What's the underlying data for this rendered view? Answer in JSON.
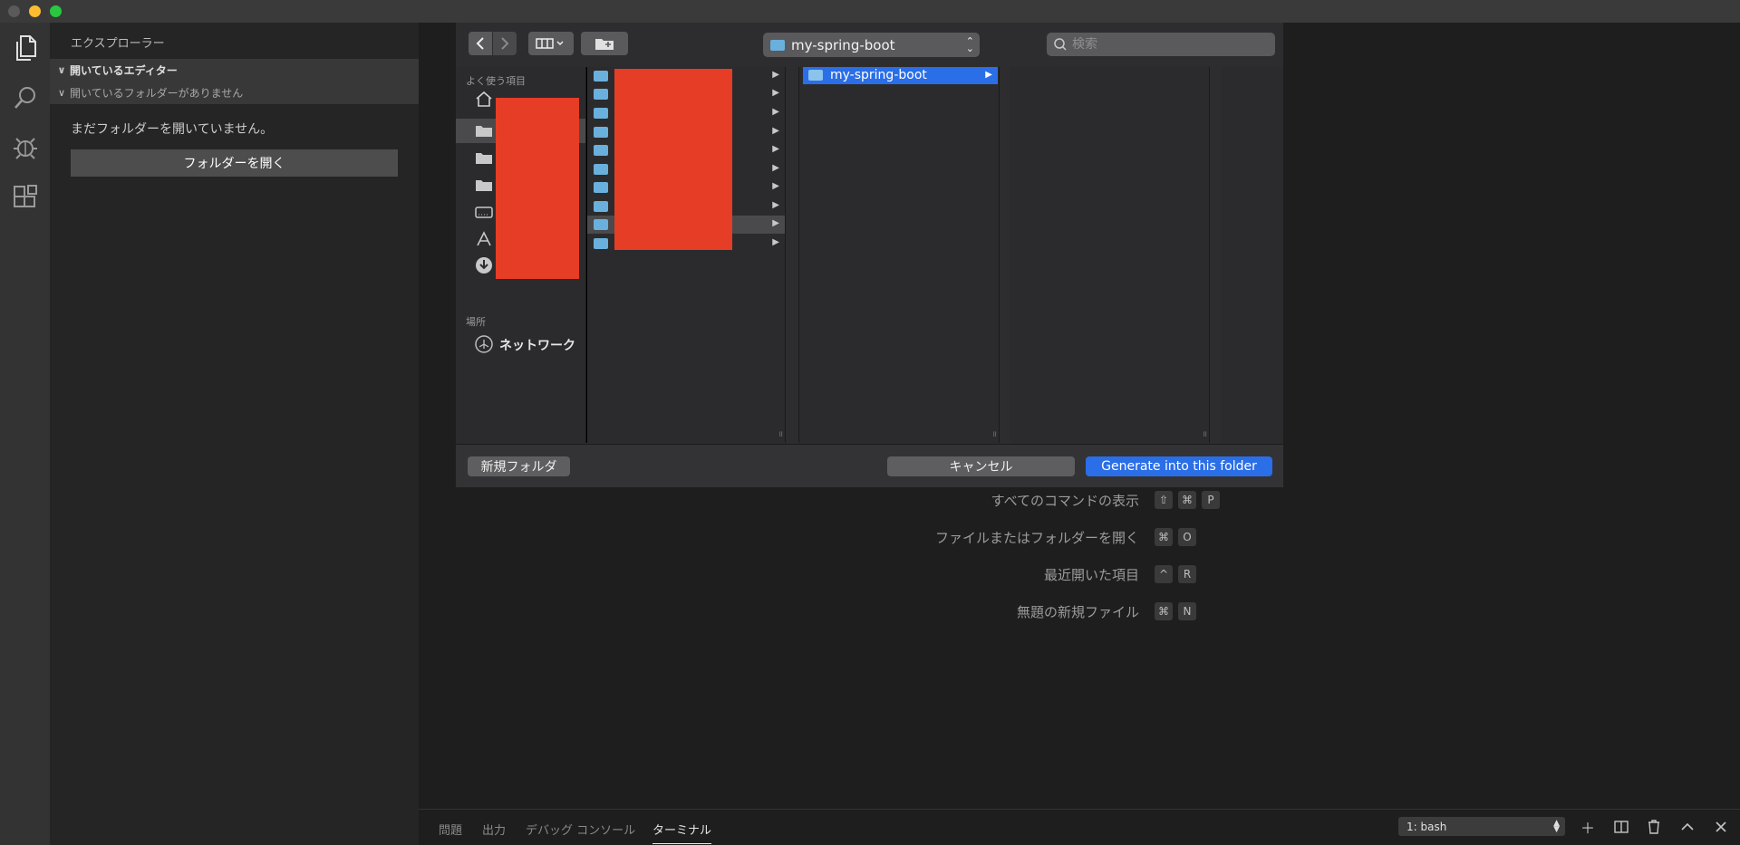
{
  "colors": {
    "accent": "#2a6ee8",
    "redaction": "#e53d26",
    "folder": "#6ab0dd",
    "traffic_red": "#ff5f57",
    "traffic_yellow": "#febc2e",
    "traffic_green": "#28c840"
  },
  "activity_bar": {
    "icons": [
      "files-icon",
      "search-icon",
      "debug-icon",
      "extensions-icon"
    ]
  },
  "sidebar": {
    "title": "エクスプローラー",
    "open_editors": "開いているエディター",
    "no_folder_section": "開いているフォルダーがありません",
    "message": "まだフォルダーを開いていません。",
    "open_folder_button": "フォルダーを開く"
  },
  "dialog": {
    "current_folder": "my-spring-boot",
    "search_placeholder": "検索",
    "favorites_heading": "よく使う項目",
    "favorites_icons": [
      "home-icon",
      "folder-icon",
      "folder-icon",
      "folder-icon",
      "drive-icon",
      "applications-icon",
      "downloads-icon"
    ],
    "places_heading": "場所",
    "network_label": "ネットワーク",
    "column2_selected": "my-spring-boot",
    "new_folder_button": "新規フォルダ",
    "cancel_button": "キャンセル",
    "confirm_button": "Generate into this folder"
  },
  "shortcuts": [
    {
      "label": "すべてのコマンドの表示",
      "keys": [
        "⇧",
        "⌘",
        "P"
      ]
    },
    {
      "label": "ファイルまたはフォルダーを開く",
      "keys": [
        "⌘",
        "O"
      ]
    },
    {
      "label": "最近開いた項目",
      "keys": [
        "^",
        "R"
      ]
    },
    {
      "label": "無題の新規ファイル",
      "keys": [
        "⌘",
        "N"
      ]
    }
  ],
  "panel": {
    "tabs": [
      "問題",
      "出力",
      "デバッグ コンソール",
      "ターミナル"
    ],
    "active_tab": "ターミナル",
    "terminal_select": "1: bash"
  }
}
